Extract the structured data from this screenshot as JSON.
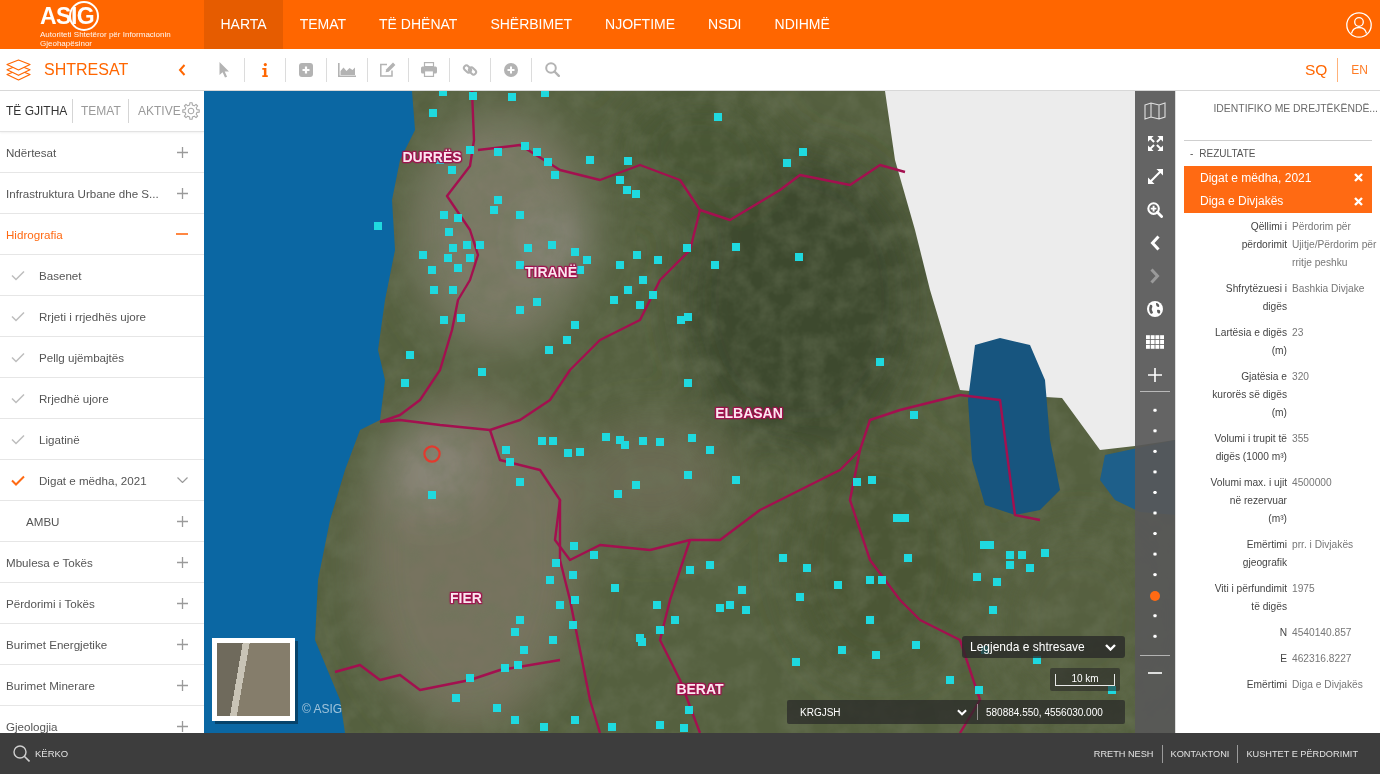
{
  "header": {
    "logo": "ASIG",
    "logo_tagline": "Autoriteti Shtetëror për Informacionin Gjeohapësinor",
    "nav": [
      {
        "label": "HARTA",
        "selected": true
      },
      {
        "label": "TEMAT",
        "selected": false
      },
      {
        "label": "TË DHËNAT",
        "selected": false
      },
      {
        "label": "SHËRBIMET",
        "selected": false
      },
      {
        "label": "NJOFTIME",
        "selected": false
      },
      {
        "label": "NSDI",
        "selected": false
      },
      {
        "label": "NDIHMË",
        "selected": false
      }
    ]
  },
  "toolbar": {
    "panel_title": "SHTRESAT",
    "tools": [
      {
        "kind": "pointer",
        "selected": false
      },
      {
        "kind": "info",
        "selected": true
      },
      {
        "kind": "add-box",
        "selected": false
      },
      {
        "kind": "area-chart",
        "selected": false
      },
      {
        "kind": "edit",
        "selected": false
      },
      {
        "kind": "print",
        "selected": false
      },
      {
        "kind": "link",
        "selected": false
      },
      {
        "kind": "add-circle",
        "selected": false
      },
      {
        "kind": "search",
        "selected": false
      }
    ],
    "languages": [
      {
        "label": "SQ",
        "selected": true
      },
      {
        "label": "EN",
        "selected": false
      }
    ]
  },
  "sidebar": {
    "tabs": [
      {
        "label": "TË GJITHA",
        "selected": true
      },
      {
        "label": "TEMAT",
        "selected": false
      },
      {
        "label": "AKTIVE",
        "selected": false
      }
    ],
    "layers": [
      {
        "label": "Ndërtesat",
        "expanded": false
      },
      {
        "label": "Infrastruktura Urbane dhe S...",
        "expanded": false
      },
      {
        "label": "Hidrografia",
        "expanded": true,
        "children": [
          {
            "kind": "layer",
            "label": "Basenet",
            "checked": false,
            "options": false
          },
          {
            "kind": "layer",
            "label": "Rrjeti i rrjedhës ujore",
            "checked": false,
            "options": false
          },
          {
            "kind": "layer",
            "label": "Pellg ujëmbajtës",
            "checked": false,
            "options": false
          },
          {
            "kind": "layer",
            "label": "Rrjedhë ujore",
            "checked": false,
            "options": false
          },
          {
            "kind": "layer",
            "label": "Ligatinë",
            "checked": false,
            "options": false
          },
          {
            "kind": "layer",
            "label": "Digat e mëdha, 2021",
            "checked": true,
            "options": true
          },
          {
            "kind": "group",
            "label": "AMBU",
            "expanded": false
          }
        ]
      },
      {
        "label": "Mbulesa e Tokës",
        "expanded": false
      },
      {
        "label": "Përdorimi i Tokës",
        "expanded": false
      },
      {
        "label": "Burimet Energjetike",
        "expanded": false
      },
      {
        "label": "Burimet Minerare",
        "expanded": false
      },
      {
        "label": "Gjeologjia",
        "expanded": false
      }
    ]
  },
  "map": {
    "place_labels": [
      "DURRËS",
      "TIRANË",
      "ELBASAN",
      "FIER",
      "BERAT"
    ],
    "copyright": "© ASIG",
    "legend_toggle": "Legjenda e shtresave",
    "scale": "10 km",
    "projection": "KRGJSH",
    "coordinates": "580884.550, 4556030.000",
    "tools": [
      {
        "kind": "basemap",
        "disabled": false
      },
      {
        "kind": "fullscreen",
        "disabled": false
      },
      {
        "kind": "extent",
        "disabled": false
      },
      {
        "kind": "zoom-box",
        "disabled": false
      },
      {
        "kind": "previous",
        "disabled": false
      },
      {
        "kind": "next",
        "disabled": true
      },
      {
        "kind": "globe",
        "disabled": false
      },
      {
        "kind": "grid",
        "disabled": false
      },
      {
        "kind": "zoom-in",
        "disabled": false
      }
    ],
    "zoom_slider": {
      "level": 0.18
    }
  },
  "identify_panel": {
    "mode": "IDENTIFIKO ME DREJTËKËNDË...",
    "results_toggle": "-",
    "results_title": "REZULTATE",
    "results": [
      {
        "label": "Digat e mëdha, 2021"
      },
      {
        "label": "Diga e Divjakës"
      }
    ],
    "attributes": [
      {
        "label": "Qëllimi i përdorimit",
        "value": "Përdorim për Ujitje/Përdorim për rritje peshku"
      },
      {
        "label": "Shfrytëzuesi i digës",
        "value": "Bashkia Divjake"
      },
      {
        "label": "Lartësia e digës (m)",
        "value": "23"
      },
      {
        "label": "Gjatësia e kurorës së digës (m)",
        "value": "320"
      },
      {
        "label": "Volumi i trupit të digës (1000 m³)",
        "value": "355"
      },
      {
        "label": "Volumi max. i ujit në rezervuar (m³)",
        "value": "4500000"
      },
      {
        "label": "Emërtimi gjeografik",
        "value": "prr. i Divjakës"
      },
      {
        "label": "Viti i përfundimit të digës",
        "value": "1975"
      },
      {
        "label": "N",
        "value": "4540140.857"
      },
      {
        "label": "E",
        "value": "462316.8227"
      },
      {
        "label": "Emërtimi",
        "value": "Diga e Divjakës"
      }
    ]
  },
  "footer": {
    "search": "KËRKO",
    "links": [
      "RRETH NESH",
      "KONTAKTONI",
      "KUSHTET E PËRDORIMIT"
    ]
  }
}
